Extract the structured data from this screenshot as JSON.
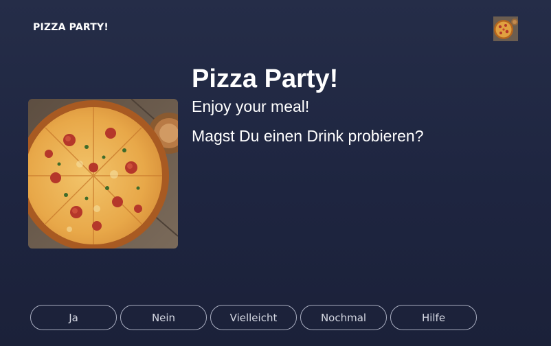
{
  "header": {
    "title": "PIZZA PARTY!",
    "thumbnail_icon": "pizza-thumbnail"
  },
  "main": {
    "image_icon": "pizza-photo",
    "title": "Pizza Party!",
    "subtitle": "Enjoy your meal!",
    "question": "Magst Du einen Drink probieren?"
  },
  "buttons": [
    {
      "label": "Ja"
    },
    {
      "label": "Nein"
    },
    {
      "label": "Vielleicht"
    },
    {
      "label": "Nochmal"
    },
    {
      "label": "Hilfe"
    }
  ],
  "colors": {
    "background_top": "#252d48",
    "background_bottom": "#1b2139",
    "pill_border": "#a9aec0",
    "pill_text": "#d6d9e3"
  }
}
